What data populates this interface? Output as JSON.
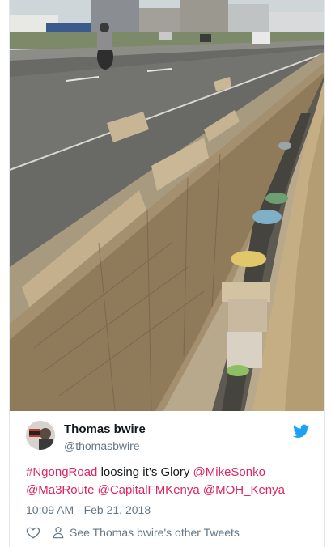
{
  "tweet": {
    "photo_alt_icon": "photo",
    "author": {
      "display_name": "Thomas bwire",
      "handle": "@thomasbwire",
      "avatar_icon": "user-avatar"
    },
    "text": {
      "hashtag": "#NgongRoad",
      "body": " loosing it’s Glory ",
      "mention_1": "@MikeSonko",
      "mention_2": "@Ma3Route",
      "mention_3": "@CapitalFMKenya",
      "mention_4": "@MOH_Kenya"
    },
    "timestamp": "10:09 AM - Feb 21, 2018",
    "actions": {
      "other_tweets_label": "See Thomas bwire's other Tweets"
    }
  },
  "colors": {
    "link": "#e0245e",
    "twitter_blue": "#1da1f2",
    "secondary_text": "#657786",
    "border": "#e1e8ed"
  }
}
